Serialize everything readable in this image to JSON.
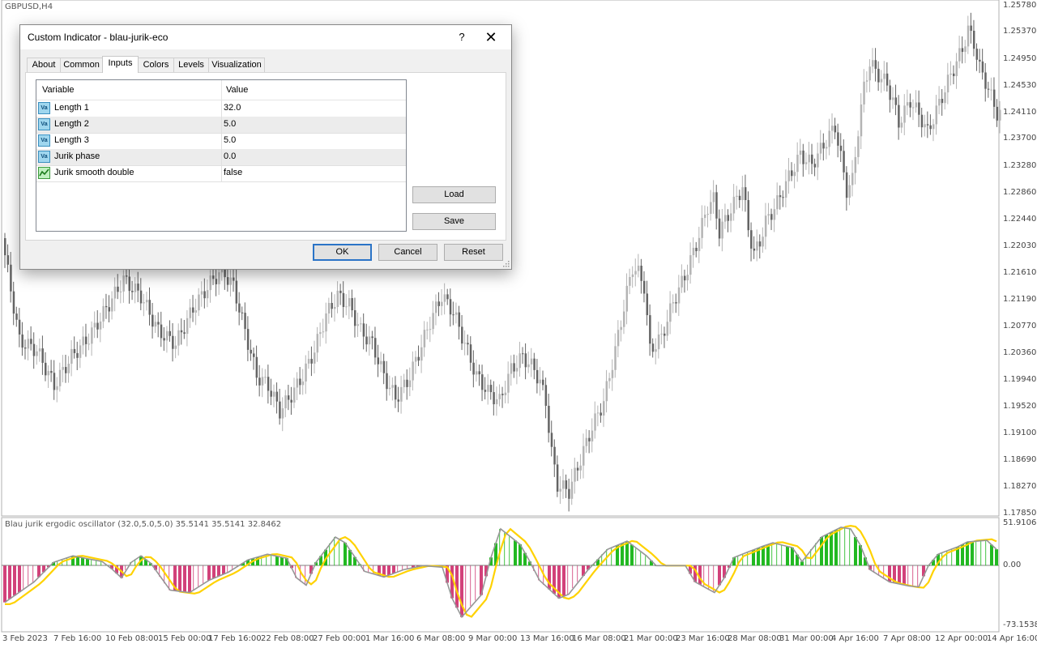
{
  "chart": {
    "symbol": "GBPUSD,H4",
    "oscillator_label": "Blau jurik ergodic oscillator (32.0,5.0,5.0) 35.5141 35.5141 32.8462",
    "price_ticks": [
      "1.25780",
      "1.25370",
      "1.24950",
      "1.24530",
      "1.24110",
      "1.23700",
      "1.23280",
      "1.22860",
      "1.22440",
      "1.22030",
      "1.21610",
      "1.21190",
      "1.20770",
      "1.20360",
      "1.19940",
      "1.19520",
      "1.19100",
      "1.18690",
      "1.18270",
      "1.17850"
    ],
    "osc_ticks": [
      "51.9106",
      "0.00",
      "-73.1538"
    ],
    "time_ticks": [
      "3 Feb 2023",
      "7 Feb 16:00",
      "10 Feb 08:00",
      "15 Feb 00:00",
      "17 Feb 16:00",
      "22 Feb 08:00",
      "27 Feb 00:00",
      "1 Mar 16:00",
      "6 Mar 08:00",
      "9 Mar 00:00",
      "13 Mar 16:00",
      "16 Mar 08:00",
      "21 Mar 00:00",
      "23 Mar 16:00",
      "28 Mar 08:00",
      "31 Mar 00:00",
      "4 Apr 16:00",
      "7 Apr 08:00",
      "12 Apr 00:00",
      "14 Apr 16:00"
    ],
    "colors": {
      "bull_candle": "#b4b4b4",
      "bear_candle": "#646464",
      "hist_pos": "#22b922",
      "hist_neg": "#d2417a",
      "signal": "#ffd200",
      "main": "#969696"
    }
  },
  "chart_data": {
    "type": "line",
    "title": "GBPUSD,H4",
    "price_path": [
      [
        0,
        1.2215
      ],
      [
        6,
        1.2055
      ],
      [
        12,
        1.204
      ],
      [
        18,
        1.1985
      ],
      [
        24,
        1.203
      ],
      [
        30,
        1.206
      ],
      [
        36,
        1.2105
      ],
      [
        42,
        1.215
      ],
      [
        48,
        1.2125
      ],
      [
        54,
        1.207
      ],
      [
        60,
        1.205
      ],
      [
        66,
        1.2105
      ],
      [
        72,
        1.2145
      ],
      [
        76,
        1.2165
      ],
      [
        80,
        1.214
      ],
      [
        84,
        1.207
      ],
      [
        88,
        1.2
      ],
      [
        92,
        1.1985
      ],
      [
        96,
        1.1945
      ],
      [
        100,
        1.197
      ],
      [
        104,
        1.2
      ],
      [
        108,
        1.204
      ],
      [
        112,
        1.2095
      ],
      [
        116,
        1.2125
      ],
      [
        120,
        1.211
      ],
      [
        124,
        1.207
      ],
      [
        128,
        1.205
      ],
      [
        132,
        1.2
      ],
      [
        136,
        1.1965
      ],
      [
        140,
        1.199
      ],
      [
        144,
        1.2035
      ],
      [
        148,
        1.2085
      ],
      [
        152,
        1.2125
      ],
      [
        156,
        1.21
      ],
      [
        160,
        1.205
      ],
      [
        164,
        1.2
      ],
      [
        168,
        1.1975
      ],
      [
        172,
        1.196
      ],
      [
        176,
        1.201
      ],
      [
        180,
        1.203
      ],
      [
        184,
        1.201
      ],
      [
        186,
        1.199
      ],
      [
        188,
        1.196
      ],
      [
        190,
        1.188
      ],
      [
        192,
        1.183
      ],
      [
        196,
        1.182
      ],
      [
        200,
        1.187
      ],
      [
        204,
        1.192
      ],
      [
        208,
        1.196
      ],
      [
        212,
        1.204
      ],
      [
        216,
        1.213
      ],
      [
        218,
        1.217
      ],
      [
        220,
        1.216
      ],
      [
        222,
        1.214
      ],
      [
        224,
        1.204
      ],
      [
        228,
        1.206
      ],
      [
        232,
        1.2115
      ],
      [
        236,
        1.2155
      ],
      [
        240,
        1.2205
      ],
      [
        242,
        1.2235
      ],
      [
        244,
        1.2265
      ],
      [
        246,
        1.2275
      ],
      [
        248,
        1.2225
      ],
      [
        252,
        1.226
      ],
      [
        256,
        1.2295
      ],
      [
        258,
        1.223
      ],
      [
        260,
        1.219
      ],
      [
        262,
        1.221
      ],
      [
        264,
        1.224
      ],
      [
        268,
        1.227
      ],
      [
        272,
        1.231
      ],
      [
        276,
        1.2345
      ],
      [
        280,
        1.233
      ],
      [
        284,
        1.236
      ],
      [
        288,
        1.239
      ],
      [
        290,
        1.234
      ],
      [
        292,
        1.229
      ],
      [
        294,
        1.2305
      ],
      [
        296,
        1.2385
      ],
      [
        298,
        1.245
      ],
      [
        300,
        1.249
      ],
      [
        302,
        1.2475
      ],
      [
        306,
        1.2455
      ],
      [
        308,
        1.243
      ],
      [
        310,
        1.2395
      ],
      [
        314,
        1.243
      ],
      [
        318,
        1.24
      ],
      [
        320,
        1.238
      ],
      [
        324,
        1.2425
      ],
      [
        328,
        1.247
      ],
      [
        332,
        1.251
      ],
      [
        334,
        1.254
      ],
      [
        336,
        1.252
      ],
      [
        338,
        1.248
      ],
      [
        340,
        1.246
      ],
      [
        344,
        1.241
      ]
    ],
    "oscillator": {
      "ylim": [
        -73.1538,
        51.9106
      ],
      "zero": 0.0,
      "path": [
        [
          0,
          -45
        ],
        [
          6,
          -20
        ],
        [
          10,
          4
        ],
        [
          14,
          12
        ],
        [
          20,
          5
        ],
        [
          22,
          -4
        ],
        [
          24,
          -15
        ],
        [
          26,
          4
        ],
        [
          28,
          12
        ],
        [
          30,
          3
        ],
        [
          34,
          -30
        ],
        [
          38,
          -33
        ],
        [
          42,
          -18
        ],
        [
          46,
          -8
        ],
        [
          50,
          7
        ],
        [
          54,
          14
        ],
        [
          58,
          9
        ],
        [
          60,
          -15
        ],
        [
          62,
          -24
        ],
        [
          64,
          4
        ],
        [
          68,
          35
        ],
        [
          70,
          28
        ],
        [
          74,
          -7
        ],
        [
          78,
          -14
        ],
        [
          82,
          -5
        ],
        [
          86,
          0
        ],
        [
          90,
          -2
        ],
        [
          92,
          -40
        ],
        [
          94,
          -63
        ],
        [
          98,
          -36
        ],
        [
          100,
          10
        ],
        [
          102,
          45
        ],
        [
          106,
          26
        ],
        [
          108,
          5
        ],
        [
          110,
          -18
        ],
        [
          114,
          -40
        ],
        [
          116,
          -35
        ],
        [
          120,
          -5
        ],
        [
          124,
          20
        ],
        [
          128,
          30
        ],
        [
          132,
          12
        ],
        [
          134,
          0
        ],
        [
          136,
          0
        ],
        [
          140,
          0
        ],
        [
          142,
          -20
        ],
        [
          146,
          -33
        ],
        [
          148,
          -15
        ],
        [
          150,
          10
        ],
        [
          156,
          24
        ],
        [
          158,
          28
        ],
        [
          162,
          22
        ],
        [
          164,
          5
        ],
        [
          168,
          35
        ],
        [
          172,
          47
        ],
        [
          174,
          45
        ],
        [
          176,
          25
        ],
        [
          178,
          -5
        ],
        [
          182,
          -20
        ],
        [
          186,
          -25
        ],
        [
          188,
          -26
        ],
        [
          190,
          0
        ],
        [
          192,
          14
        ],
        [
          196,
          23
        ],
        [
          198,
          29
        ],
        [
          202,
          31
        ],
        [
          204,
          20
        ]
      ]
    },
    "xlabel": "",
    "ylabel": ""
  },
  "dialog": {
    "title": "Custom Indicator - blau-jurik-eco",
    "help_label": "?",
    "close_label": "✕",
    "tabs": [
      "About",
      "Common",
      "Inputs",
      "Colors",
      "Levels",
      "Visualization"
    ],
    "active_tab": "Inputs",
    "columns": [
      "Variable",
      "Value"
    ],
    "rows": [
      {
        "icon": "value-icon",
        "name": "Length 1",
        "value": "32.0"
      },
      {
        "icon": "value-icon",
        "name": "Length 2",
        "value": "5.0"
      },
      {
        "icon": "value-icon",
        "name": "Length 3",
        "value": "5.0"
      },
      {
        "icon": "value-icon",
        "name": "Jurik phase",
        "value": "0.0"
      },
      {
        "icon": "bool-icon",
        "name": "Jurik smooth double",
        "value": "false"
      }
    ],
    "icon_text": "Va",
    "load_label": "Load",
    "save_label": "Save",
    "ok_label": "OK",
    "cancel_label": "Cancel",
    "reset_label": "Reset"
  }
}
